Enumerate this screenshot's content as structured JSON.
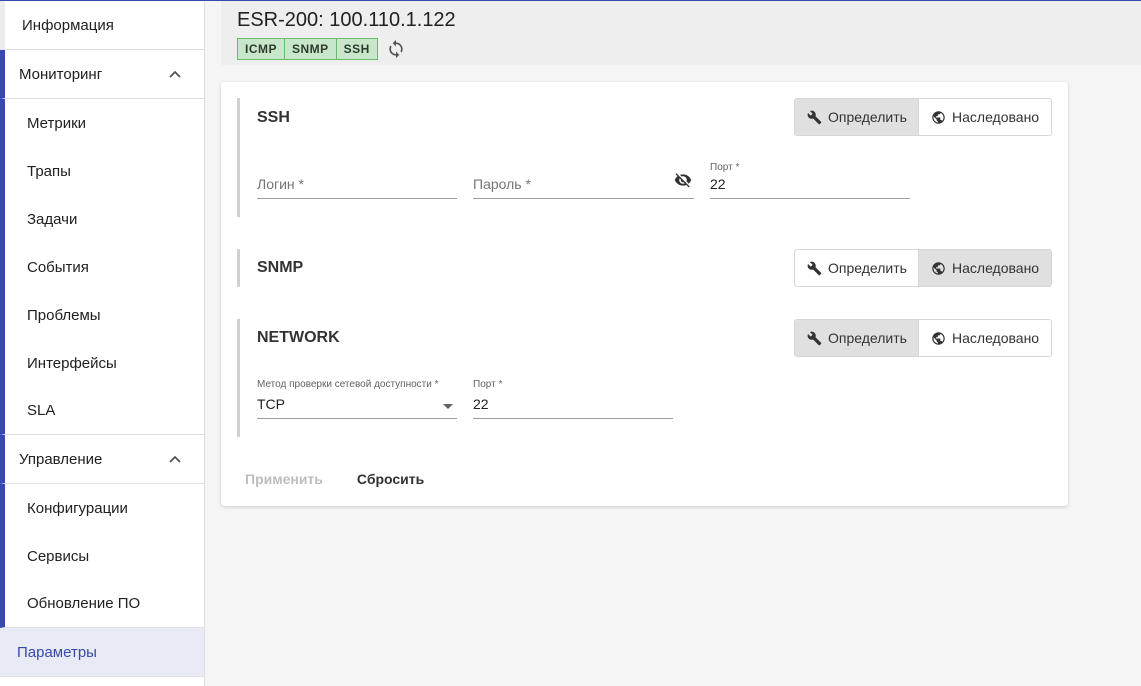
{
  "sidebar": {
    "info": "Информация",
    "monitoring": {
      "label": "Мониторинг",
      "items": [
        "Метрики",
        "Трапы",
        "Задачи",
        "События",
        "Проблемы",
        "Интерфейсы",
        "SLA"
      ]
    },
    "management": {
      "label": "Управление",
      "items": [
        "Конфигурации",
        "Сервисы",
        "Обновление ПО"
      ]
    },
    "params": "Параметры"
  },
  "header": {
    "title": "ESR-200: 100.110.1.122",
    "chips": [
      "ICMP",
      "SNMP",
      "SSH"
    ],
    "refresh_icon": "refresh-icon"
  },
  "sections": {
    "ssh": {
      "title": "SSH",
      "define_label": "Определить",
      "inherit_label": "Наследовано",
      "login_placeholder": "Логин *",
      "password_placeholder": "Пароль *",
      "port_label": "Порт *",
      "port_value": "22"
    },
    "snmp": {
      "title": "SNMP",
      "define_label": "Определить",
      "inherit_label": "Наследовано"
    },
    "network": {
      "title": "NETWORK",
      "define_label": "Определить",
      "inherit_label": "Наследовано",
      "method_label": "Метод проверки сетевой доступности *",
      "method_value": "TCP",
      "port_label": "Порт *",
      "port_value": "22"
    }
  },
  "actions": {
    "apply": "Применить",
    "reset": "Сбросить"
  },
  "colors": {
    "accent": "#3949ab",
    "chip_bg": "#c8e6c9",
    "chip_border": "#66bb6a"
  }
}
